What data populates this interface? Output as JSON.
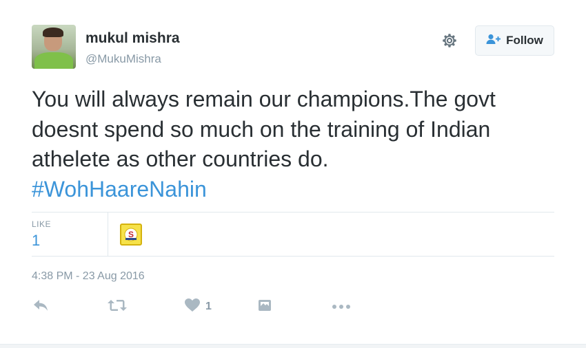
{
  "user": {
    "name": "mukul mishra",
    "handle": "@MukuMishra",
    "avatar_icon": "user-avatar-photo"
  },
  "header": {
    "settings_icon": "gear-icon",
    "follow_label": "Follow",
    "follow_icon": "add-user-icon"
  },
  "tweet": {
    "text": "You will always remain our champions.The govt doesnt spend so much on the training of Indian athelete as other countries do.",
    "hashtag": "#WohHaareNahin"
  },
  "stats": {
    "like_label": "LIKE",
    "like_count": "1"
  },
  "timestamp": "4:38 PM - 23 Aug 2016",
  "actions": {
    "reply_icon": "reply-icon",
    "retweet_icon": "retweet-icon",
    "like_icon": "heart-icon",
    "like_count": "1",
    "moment_icon": "moment-icon",
    "more_icon": "more-icon"
  },
  "colors": {
    "link": "#3b94d9",
    "muted": "#8899a6",
    "text": "#292f33",
    "icon": "#aab8c2"
  }
}
